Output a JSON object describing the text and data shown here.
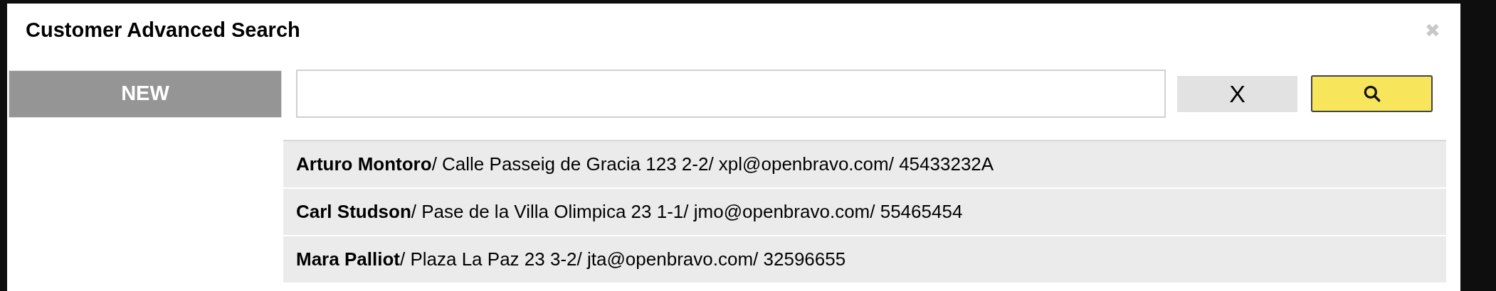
{
  "dialog": {
    "title": "Customer Advanced Search",
    "close": "✖"
  },
  "new_button": {
    "label": "NEW"
  },
  "clear_button": {
    "label": "X"
  },
  "results": [
    {
      "text": "**Arturo Montoro**/ Calle Passeig de Gracia 123 2-2/ xpl@openbravo.com/ 45433232A"
    },
    {
      "text": "**Carl Studson**/ Pase de la Villa Olimpica 23 1-1/ jmo@openbravo.com/ 55465454"
    },
    {
      "text": "**Mara Palliot**/ Plaza La Paz 23 3-2/ jta@openbravo.com/ 32596655"
    }
  ]
}
